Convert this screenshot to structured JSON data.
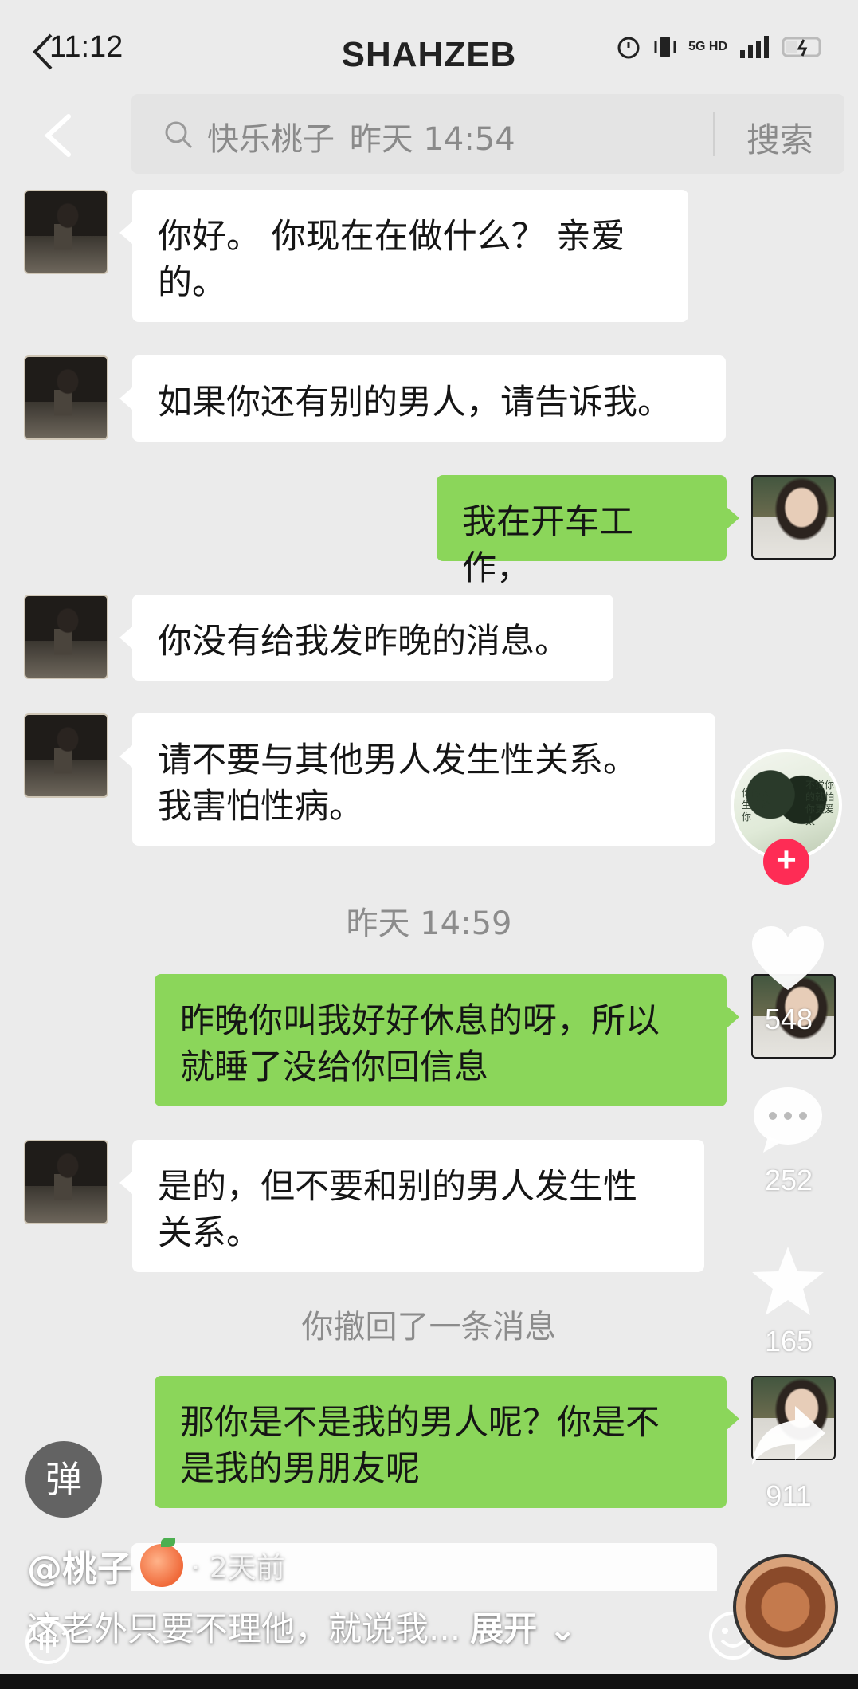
{
  "status_bar": {
    "time": "11:12",
    "network": "5G HD"
  },
  "header": {
    "title": "SHAHZEB"
  },
  "search": {
    "query": "快乐桃子",
    "time": "昨天 14:54",
    "button": "搜索"
  },
  "messages": [
    {
      "side": "left",
      "text_lines": [
        "你好。 你现在在做什么？ 亲爱",
        "的。"
      ]
    },
    {
      "side": "left",
      "text_lines": [
        "如果你还有别的男人，请告诉我。"
      ]
    },
    {
      "side": "right",
      "text_lines": [
        "我在开车工作，"
      ]
    },
    {
      "side": "left",
      "text_lines": [
        "你没有给我发昨晚的消息。"
      ]
    },
    {
      "side": "left",
      "text_lines": [
        "请不要与其他男人发生性关系。",
        "我害怕性病。"
      ]
    },
    {
      "side": "system",
      "text_lines": [
        "昨天 14:59"
      ]
    },
    {
      "side": "right",
      "text_lines": [
        "昨晚你叫我好好休息的呀，所以",
        "就睡了没给你回信息"
      ]
    },
    {
      "side": "left",
      "text_lines": [
        "是的，但不要和别的男人发生性",
        "关系。"
      ]
    },
    {
      "side": "system",
      "text_lines": [
        "你撤回了一条消息"
      ]
    },
    {
      "side": "right",
      "text_lines": [
        "那你是不是我的男人呢？你是不",
        "是我的男朋友呢"
      ]
    }
  ],
  "creator_avatar_text": [
    "你的人生怕给你",
    "不觉你的就怕你更爱太"
  ],
  "side_actions": {
    "likes": "548",
    "comments": "252",
    "favorites": "165",
    "shares": "911",
    "follow": "+"
  },
  "danmu_label": "弹",
  "video_info": {
    "author": "@桃子",
    "posted": "· 2天前",
    "caption": "这老外只要不理他，就说我...",
    "expand": "展开"
  },
  "colors": {
    "sent_bubble": "#8bd65a",
    "received_bubble": "#ffffff",
    "follow": "#fe2c55",
    "background": "#ebebeb"
  }
}
